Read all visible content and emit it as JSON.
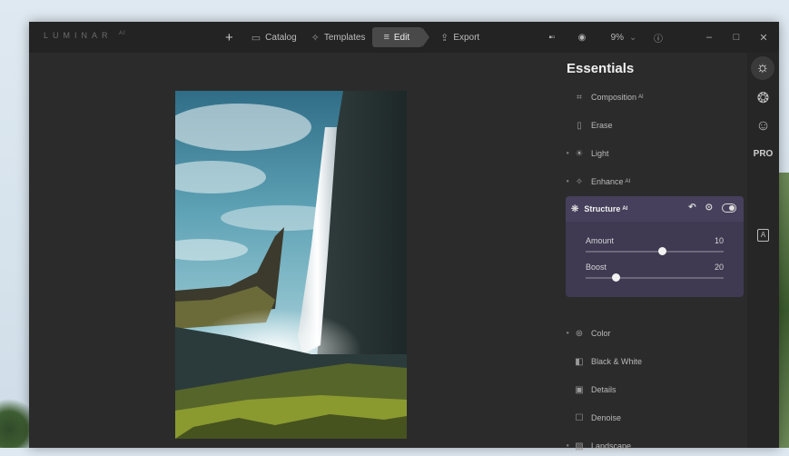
{
  "app": {
    "logo": "LUMINAR",
    "logo_version": "AI"
  },
  "nav": {
    "add_icon": "plus-icon",
    "items": [
      {
        "label": "Catalog",
        "icon": "folder-icon"
      },
      {
        "label": "Templates",
        "icon": "sparkle-icon"
      },
      {
        "label": "Edit",
        "icon": "sliders-icon"
      },
      {
        "label": "Export",
        "icon": "share-icon"
      }
    ]
  },
  "toolbar": {
    "zoom": "9%",
    "zoom_caret": "⌄"
  },
  "panel": {
    "title": "Essentials",
    "tools": [
      {
        "label": "Composition",
        "icon": "crop-icon",
        "ai": "AI"
      },
      {
        "label": "Erase",
        "icon": "eraser-icon"
      },
      {
        "label": "Light",
        "icon": "sun-icon"
      },
      {
        "label": "Enhance",
        "icon": "sparkle-icon",
        "ai": "AI"
      },
      {
        "label": "Color",
        "icon": "color-circles-icon"
      },
      {
        "label": "Black & White",
        "icon": "bw-icon"
      },
      {
        "label": "Details",
        "icon": "details-icon"
      },
      {
        "label": "Denoise",
        "icon": "denoise-icon"
      },
      {
        "label": "Landscape",
        "icon": "landscape-icon"
      }
    ],
    "structure": {
      "label": "Structure",
      "ai": "AI",
      "sliders": [
        {
          "label": "Amount",
          "value": "10",
          "fraction": 0.55
        },
        {
          "label": "Boost",
          "value": "20",
          "fraction": 0.22
        }
      ]
    }
  },
  "sidebar": {
    "pro_label": "PRO"
  },
  "colors": {
    "accent_panel": "#3f3a52",
    "app_bg": "#2b2b2b",
    "titlebar": "#232323"
  }
}
